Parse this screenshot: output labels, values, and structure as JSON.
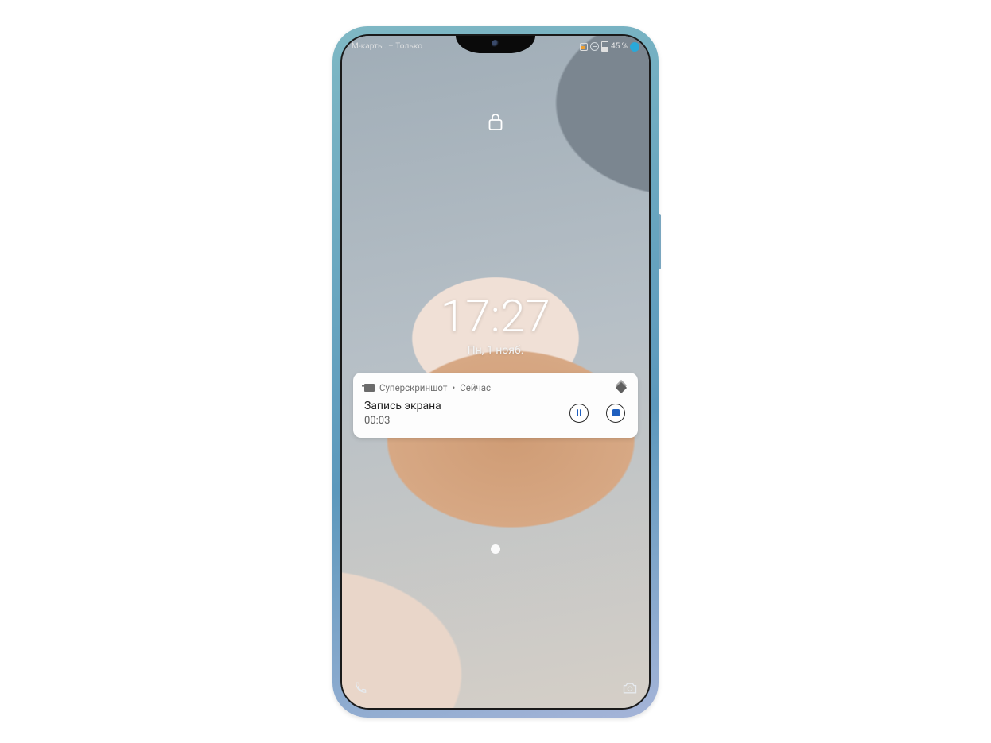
{
  "status": {
    "left_text": "М-карты. – Только",
    "battery_text": "45 %"
  },
  "clock": {
    "time": "17:27",
    "date": "Пн, 1 нояб."
  },
  "notification": {
    "app_name": "Суперскриншот",
    "time_label": "Сейчас",
    "separator": " • ",
    "title": "Запись экрана",
    "elapsed": "00:03"
  }
}
